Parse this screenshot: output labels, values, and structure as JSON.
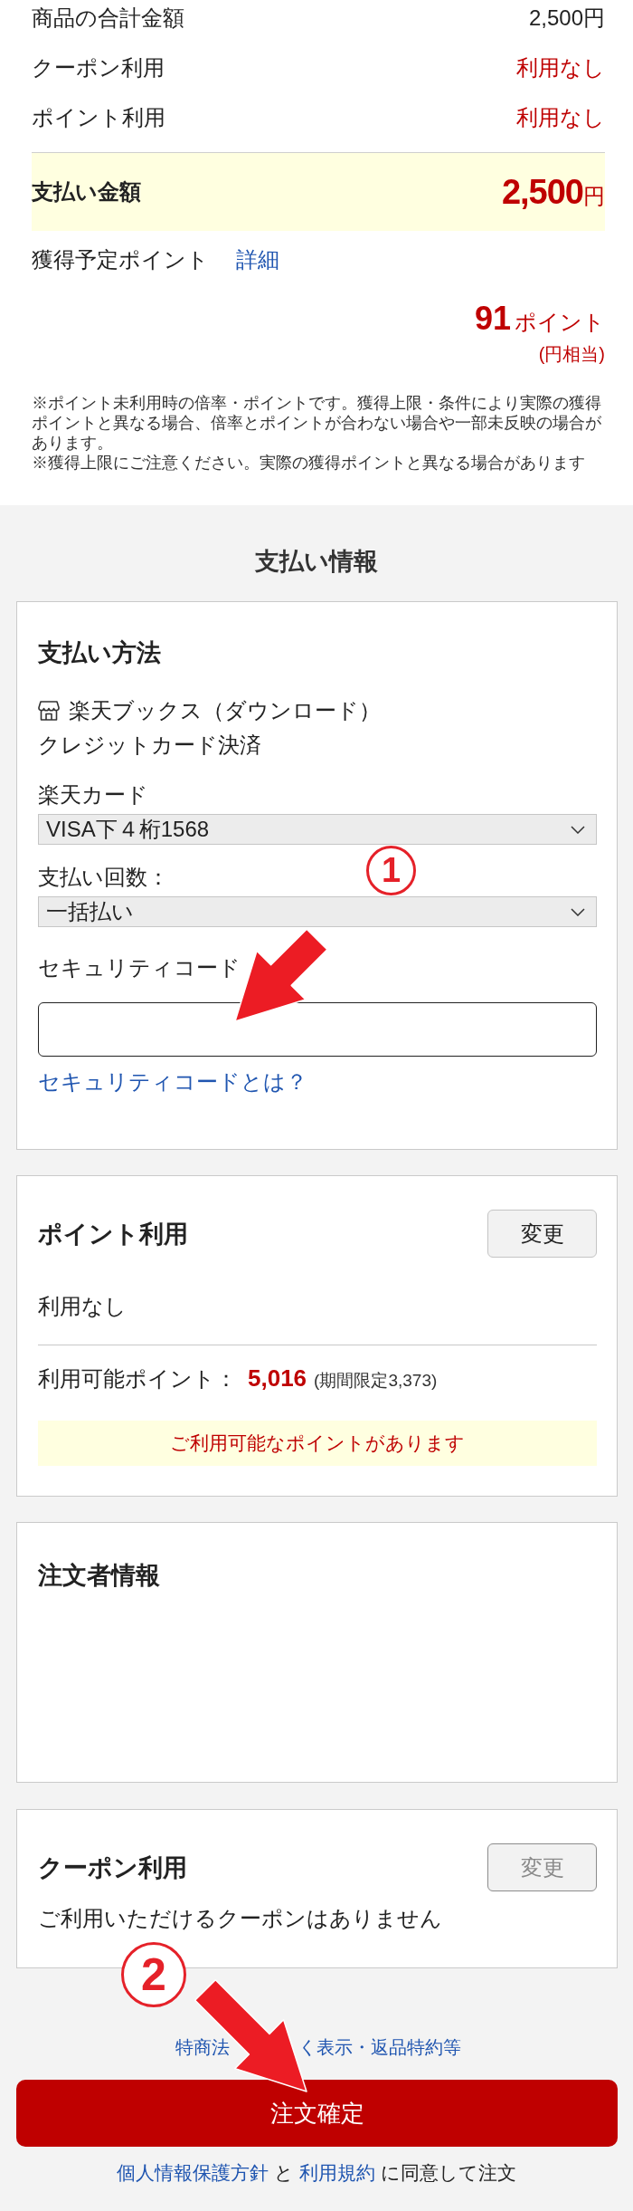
{
  "summary": {
    "rows": [
      {
        "label": "商品の合計金額",
        "value": "2,500円",
        "kind": "plain"
      },
      {
        "label": "クーポン利用",
        "value": "利用なし",
        "kind": "alert"
      },
      {
        "label": "ポイント利用",
        "value": "利用なし",
        "kind": "alert"
      }
    ],
    "total": {
      "label": "支払い金額",
      "amount": "2,500",
      "unit": "円"
    },
    "earned_points": {
      "label": "獲得予定ポイント",
      "link": "詳細",
      "amount": "91",
      "unit": "ポイント",
      "note": "(円相当)"
    },
    "notes": [
      "※ポイント未利用時の倍率・ポイントです。獲得上限・条件により実際の獲得ポイントと異なる場合、倍率とポイントが合わない場合や一部未反映の場合があります。",
      "※獲得上限にご注意ください。実際の獲得ポイントと異なる場合があります"
    ]
  },
  "section_title": "支払い情報",
  "payment_method": {
    "title": "支払い方法",
    "shop": "楽天ブックス（ダウンロード）",
    "method": "クレジットカード決済",
    "selects": [
      {
        "label": "楽天カード",
        "value": "VISA下４桁1568"
      },
      {
        "label": "支払い回数：",
        "value": "一括払い"
      }
    ],
    "security_code": {
      "label": "セキュリティコード",
      "help_link": "セキュリティコードとは？"
    },
    "callout": {
      "number": "1"
    }
  },
  "point_usage": {
    "title": "ポイント利用",
    "button": {
      "label": "変更",
      "disabled": false
    },
    "status": "利用なし",
    "available": {
      "label": "利用可能ポイント：",
      "value": "5,016",
      "limited": "(期間限定3,373)"
    },
    "notice": "ご利用可能なポイントがあります"
  },
  "orderer_info": {
    "title": "注文者情報"
  },
  "coupon": {
    "title": "クーポン利用",
    "button": {
      "label": "変更",
      "disabled": true
    },
    "status": "ご利用いただけるクーポンはありません"
  },
  "legal_link": {
    "parts": [
      "特商法",
      "く表示・返品特約等"
    ]
  },
  "submit_button": {
    "label": "注文確定",
    "callout": {
      "number": "2"
    }
  },
  "consent": [
    {
      "kind": "link",
      "text": "個人情報保護方針"
    },
    {
      "kind": "text",
      "text": " と "
    },
    {
      "kind": "link",
      "text": "利用規約"
    },
    {
      "kind": "text",
      "text": " に同意して注文"
    }
  ]
}
